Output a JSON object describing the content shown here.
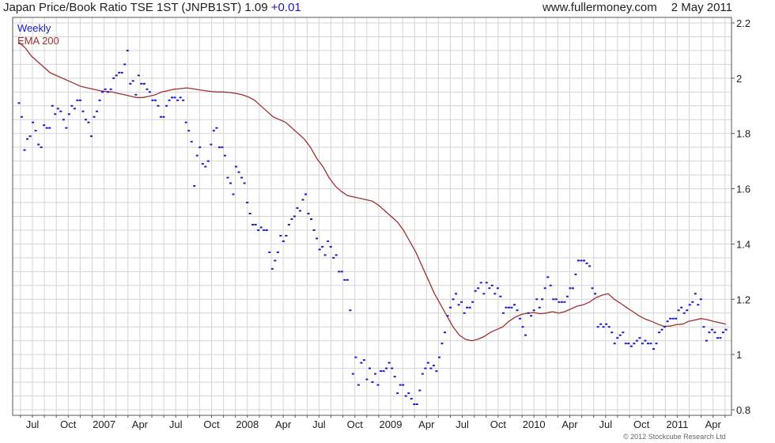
{
  "header": {
    "title": "Japan Price/Book Ratio TSE 1ST (JNPB1ST)",
    "last": "1.09",
    "change": "+0.01",
    "site": "www.fullermoney.com",
    "date": "2 May 2011"
  },
  "credit": "© 2012 Stockcube Research Ltd",
  "colors": {
    "weekly": "#1a1acc",
    "ema": "#a03030",
    "grid": "#d4d4d4",
    "axis": "#555555"
  },
  "chart_data": {
    "type": "scatter",
    "title": "Japan Price/Book Ratio TSE 1ST (JNPB1ST)",
    "ylim": [
      0.78,
      2.22
    ],
    "y_ticks": [
      0.8,
      1,
      1.2,
      1.4,
      1.6,
      1.8,
      2,
      2.2
    ],
    "grid": true,
    "legend_position": "top-left",
    "x_labels": [
      "Jul",
      "Oct",
      "2007",
      "Apr",
      "Jul",
      "Oct",
      "2008",
      "Apr",
      "Jul",
      "Oct",
      "2009",
      "Apr",
      "Jul",
      "Oct",
      "2010",
      "Apr",
      "Jul",
      "Oct",
      "2011",
      "Apr"
    ],
    "series": [
      {
        "name": "Weekly",
        "style": "dot",
        "values": [
          1.91,
          1.86,
          1.74,
          1.78,
          1.79,
          1.84,
          1.81,
          1.76,
          1.75,
          1.83,
          1.82,
          1.82,
          1.9,
          1.87,
          1.89,
          1.88,
          1.85,
          1.82,
          1.87,
          1.9,
          1.89,
          1.92,
          1.92,
          1.88,
          1.85,
          1.84,
          1.79,
          1.86,
          1.88,
          1.92,
          1.95,
          1.96,
          1.95,
          1.96,
          2.0,
          2.01,
          2.02,
          2.02,
          2.05,
          2.1,
          1.98,
          1.99,
          1.94,
          2.01,
          1.98,
          1.98,
          1.96,
          1.95,
          1.92,
          1.92,
          1.9,
          1.86,
          1.86,
          1.9,
          1.92,
          1.93,
          1.93,
          1.92,
          1.93,
          1.92,
          1.84,
          1.81,
          1.77,
          1.61,
          1.72,
          1.75,
          1.69,
          1.68,
          1.7,
          1.76,
          1.81,
          1.82,
          1.75,
          1.75,
          1.72,
          1.64,
          1.62,
          1.58,
          1.68,
          1.66,
          1.64,
          1.62,
          1.55,
          1.51,
          1.47,
          1.47,
          1.45,
          1.46,
          1.45,
          1.45,
          1.37,
          1.31,
          1.34,
          1.37,
          1.43,
          1.41,
          1.43,
          1.47,
          1.49,
          1.5,
          1.53,
          1.52,
          1.56,
          1.58,
          1.51,
          1.49,
          1.45,
          1.42,
          1.38,
          1.39,
          1.36,
          1.41,
          1.39,
          1.35,
          1.36,
          1.3,
          1.3,
          1.27,
          1.27,
          1.16,
          0.93,
          0.99,
          0.89,
          0.97,
          0.98,
          0.91,
          0.95,
          0.9,
          0.93,
          0.89,
          0.94,
          0.94,
          0.95,
          0.97,
          0.95,
          0.92,
          0.86,
          0.89,
          0.89,
          0.85,
          0.86,
          0.84,
          0.82,
          0.82,
          0.87,
          0.93,
          0.95,
          0.97,
          0.95,
          0.96,
          0.94,
          0.99,
          1.04,
          1.08,
          1.14,
          1.17,
          1.2,
          1.22,
          1.18,
          1.19,
          1.15,
          1.17,
          1.17,
          1.19,
          1.23,
          1.24,
          1.26,
          1.22,
          1.26,
          1.24,
          1.25,
          1.22,
          1.24,
          1.21,
          1.15,
          1.17,
          1.17,
          1.17,
          1.18,
          1.16,
          1.13,
          1.1,
          1.07,
          1.15,
          1.14,
          1.16,
          1.2,
          1.17,
          1.2,
          1.24,
          1.28,
          1.25,
          1.2,
          1.2,
          1.19,
          1.19,
          1.19,
          1.21,
          1.24,
          1.24,
          1.29,
          1.34,
          1.34,
          1.34,
          1.33,
          1.32,
          1.24,
          1.22,
          1.1,
          1.11,
          1.1,
          1.11,
          1.1,
          1.08,
          1.04,
          1.06,
          1.07,
          1.08,
          1.04,
          1.04,
          1.03,
          1.04,
          1.05,
          1.06,
          1.04,
          1.05,
          1.04,
          1.04,
          1.02,
          1.04,
          1.08,
          1.09,
          1.1,
          1.12,
          1.13,
          1.13,
          1.13,
          1.16,
          1.17,
          1.15,
          1.16,
          1.18,
          1.19,
          1.22,
          1.18,
          1.2,
          1.1,
          1.05,
          1.08,
          1.09,
          1.08,
          1.06,
          1.06,
          1.08,
          1.09
        ]
      },
      {
        "name": "EMA 200",
        "style": "line",
        "values": [
          2.13,
          2.11,
          2.08,
          2.06,
          2.04,
          2.02,
          2.01,
          2.0,
          1.99,
          1.98,
          1.97,
          1.965,
          1.96,
          1.955,
          1.952,
          1.95,
          1.945,
          1.94,
          1.935,
          1.93,
          1.93,
          1.935,
          1.94,
          1.95,
          1.955,
          1.96,
          1.962,
          1.965,
          1.962,
          1.958,
          1.955,
          1.952,
          1.95,
          1.95,
          1.948,
          1.945,
          1.94,
          1.932,
          1.92,
          1.9,
          1.88,
          1.86,
          1.85,
          1.84,
          1.82,
          1.8,
          1.78,
          1.75,
          1.71,
          1.68,
          1.64,
          1.61,
          1.59,
          1.575,
          1.57,
          1.565,
          1.56,
          1.555,
          1.54,
          1.52,
          1.5,
          1.48,
          1.45,
          1.41,
          1.37,
          1.32,
          1.27,
          1.22,
          1.18,
          1.14,
          1.1,
          1.07,
          1.055,
          1.05,
          1.055,
          1.065,
          1.08,
          1.09,
          1.1,
          1.12,
          1.135,
          1.145,
          1.15,
          1.152,
          1.148,
          1.15,
          1.155,
          1.15,
          1.155,
          1.165,
          1.175,
          1.18,
          1.19,
          1.205,
          1.215,
          1.22,
          1.2,
          1.185,
          1.17,
          1.155,
          1.14,
          1.128,
          1.12,
          1.11,
          1.102,
          1.103,
          1.108,
          1.11,
          1.12,
          1.125,
          1.13,
          1.126,
          1.12,
          1.115,
          1.11
        ]
      }
    ]
  }
}
